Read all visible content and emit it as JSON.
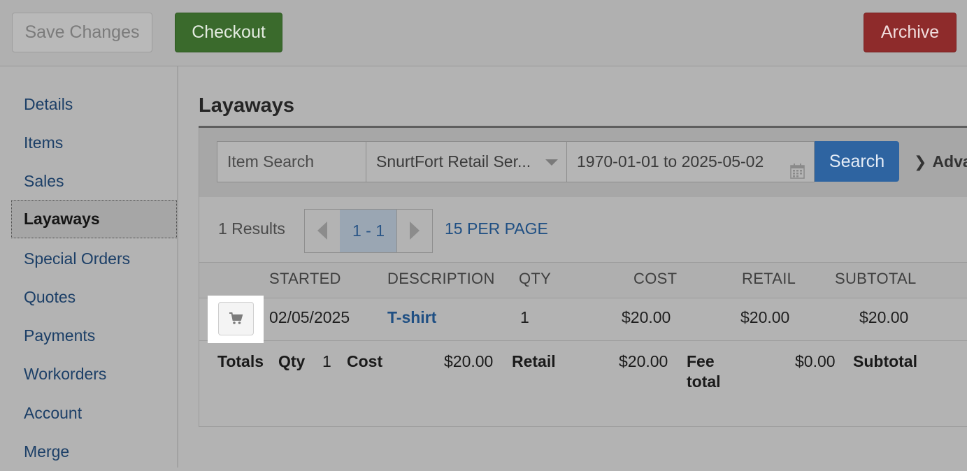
{
  "toolbar": {
    "save_label": "Save Changes",
    "checkout_label": "Checkout",
    "archive_label": "Archive"
  },
  "sidebar": {
    "items": [
      {
        "label": "Details",
        "active": false
      },
      {
        "label": "Items",
        "active": false
      },
      {
        "label": "Sales",
        "active": false
      },
      {
        "label": "Layaways",
        "active": true
      },
      {
        "label": "Special Orders",
        "active": false
      },
      {
        "label": "Quotes",
        "active": false
      },
      {
        "label": "Payments",
        "active": false
      },
      {
        "label": "Workorders",
        "active": false
      },
      {
        "label": "Account",
        "active": false
      },
      {
        "label": "Merge",
        "active": false
      }
    ]
  },
  "main": {
    "title": "Layaways",
    "filters": {
      "item_search_placeholder": "Item Search",
      "shop_value": "SnurtFort Retail Ser...",
      "date_range_value": "1970-01-01 to 2025-05-02",
      "search_label": "Search",
      "advanced_label": "Adva"
    },
    "results": {
      "count_text": "1 Results",
      "page_range": "1 - 1",
      "per_page": "15 PER PAGE"
    },
    "table": {
      "headers": {
        "started": "STARTED",
        "description": "DESCRIPTION",
        "qty": "QTY",
        "cost": "COST",
        "retail": "RETAIL",
        "subtotal": "SUBTOTAL"
      },
      "rows": [
        {
          "started": "02/05/2025",
          "description": "T-shirt",
          "qty": "1",
          "cost": "$20.00",
          "retail": "$20.00",
          "subtotal": "$20.00"
        }
      ]
    },
    "totals": {
      "label": "Totals",
      "qty_label": "Qty",
      "qty_value": "1",
      "cost_label": "Cost",
      "cost_value": "$20.00",
      "retail_label": "Retail",
      "retail_value": "$20.00",
      "fee_label_line1": "Fee",
      "fee_label_line2": "total",
      "fee_value": "$0.00",
      "subtotal_label": "Subtotal"
    }
  },
  "icons": {
    "cart": "cart-icon",
    "calendar": "calendar-icon",
    "dropdown": "chevron-down-icon",
    "advanced": "chevron-right-icon"
  },
  "colors": {
    "checkout": "#3a6a2c",
    "archive": "#8e2b2b",
    "search": "#2e64a1",
    "link": "#1f4f83"
  }
}
